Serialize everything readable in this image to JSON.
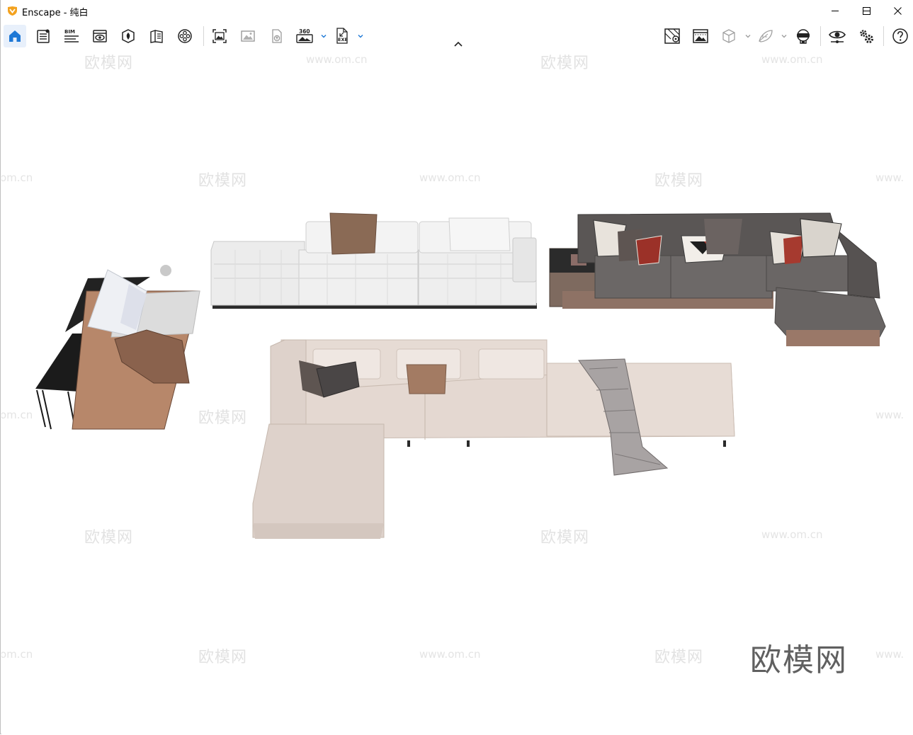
{
  "window": {
    "app_name": "Enscape",
    "title": "Enscape - 纯白",
    "controls": {
      "minimize": "minimize",
      "maximize": "maximize",
      "close": "close"
    }
  },
  "toolbar": {
    "left_icons": [
      "home-icon",
      "notes-icon",
      "bim-icon",
      "visual-settings-icon",
      "asset-library-icon",
      "views-icon",
      "video-editor-icon",
      "screenshot-icon",
      "batch-render-icon",
      "upload-icon",
      "panorama-icon",
      "export-exe-icon"
    ],
    "bim_label": "BIM",
    "panorama_label": "360",
    "exe_label": "EXE",
    "right_icons": [
      "map-icon",
      "view-management-icon",
      "cube-icon",
      "material-icon",
      "vr-headset-icon",
      "viewer-icon",
      "settings-icon",
      "help-icon"
    ],
    "accent_color": "#1e78d6"
  },
  "viewport": {
    "background": "#ffffff",
    "watermark_logo": "欧模网",
    "watermark_url": "www.om.cn",
    "watermark_edge_left": "om.cn",
    "watermark_edge_right": "www.",
    "brand_text": "欧模网"
  }
}
